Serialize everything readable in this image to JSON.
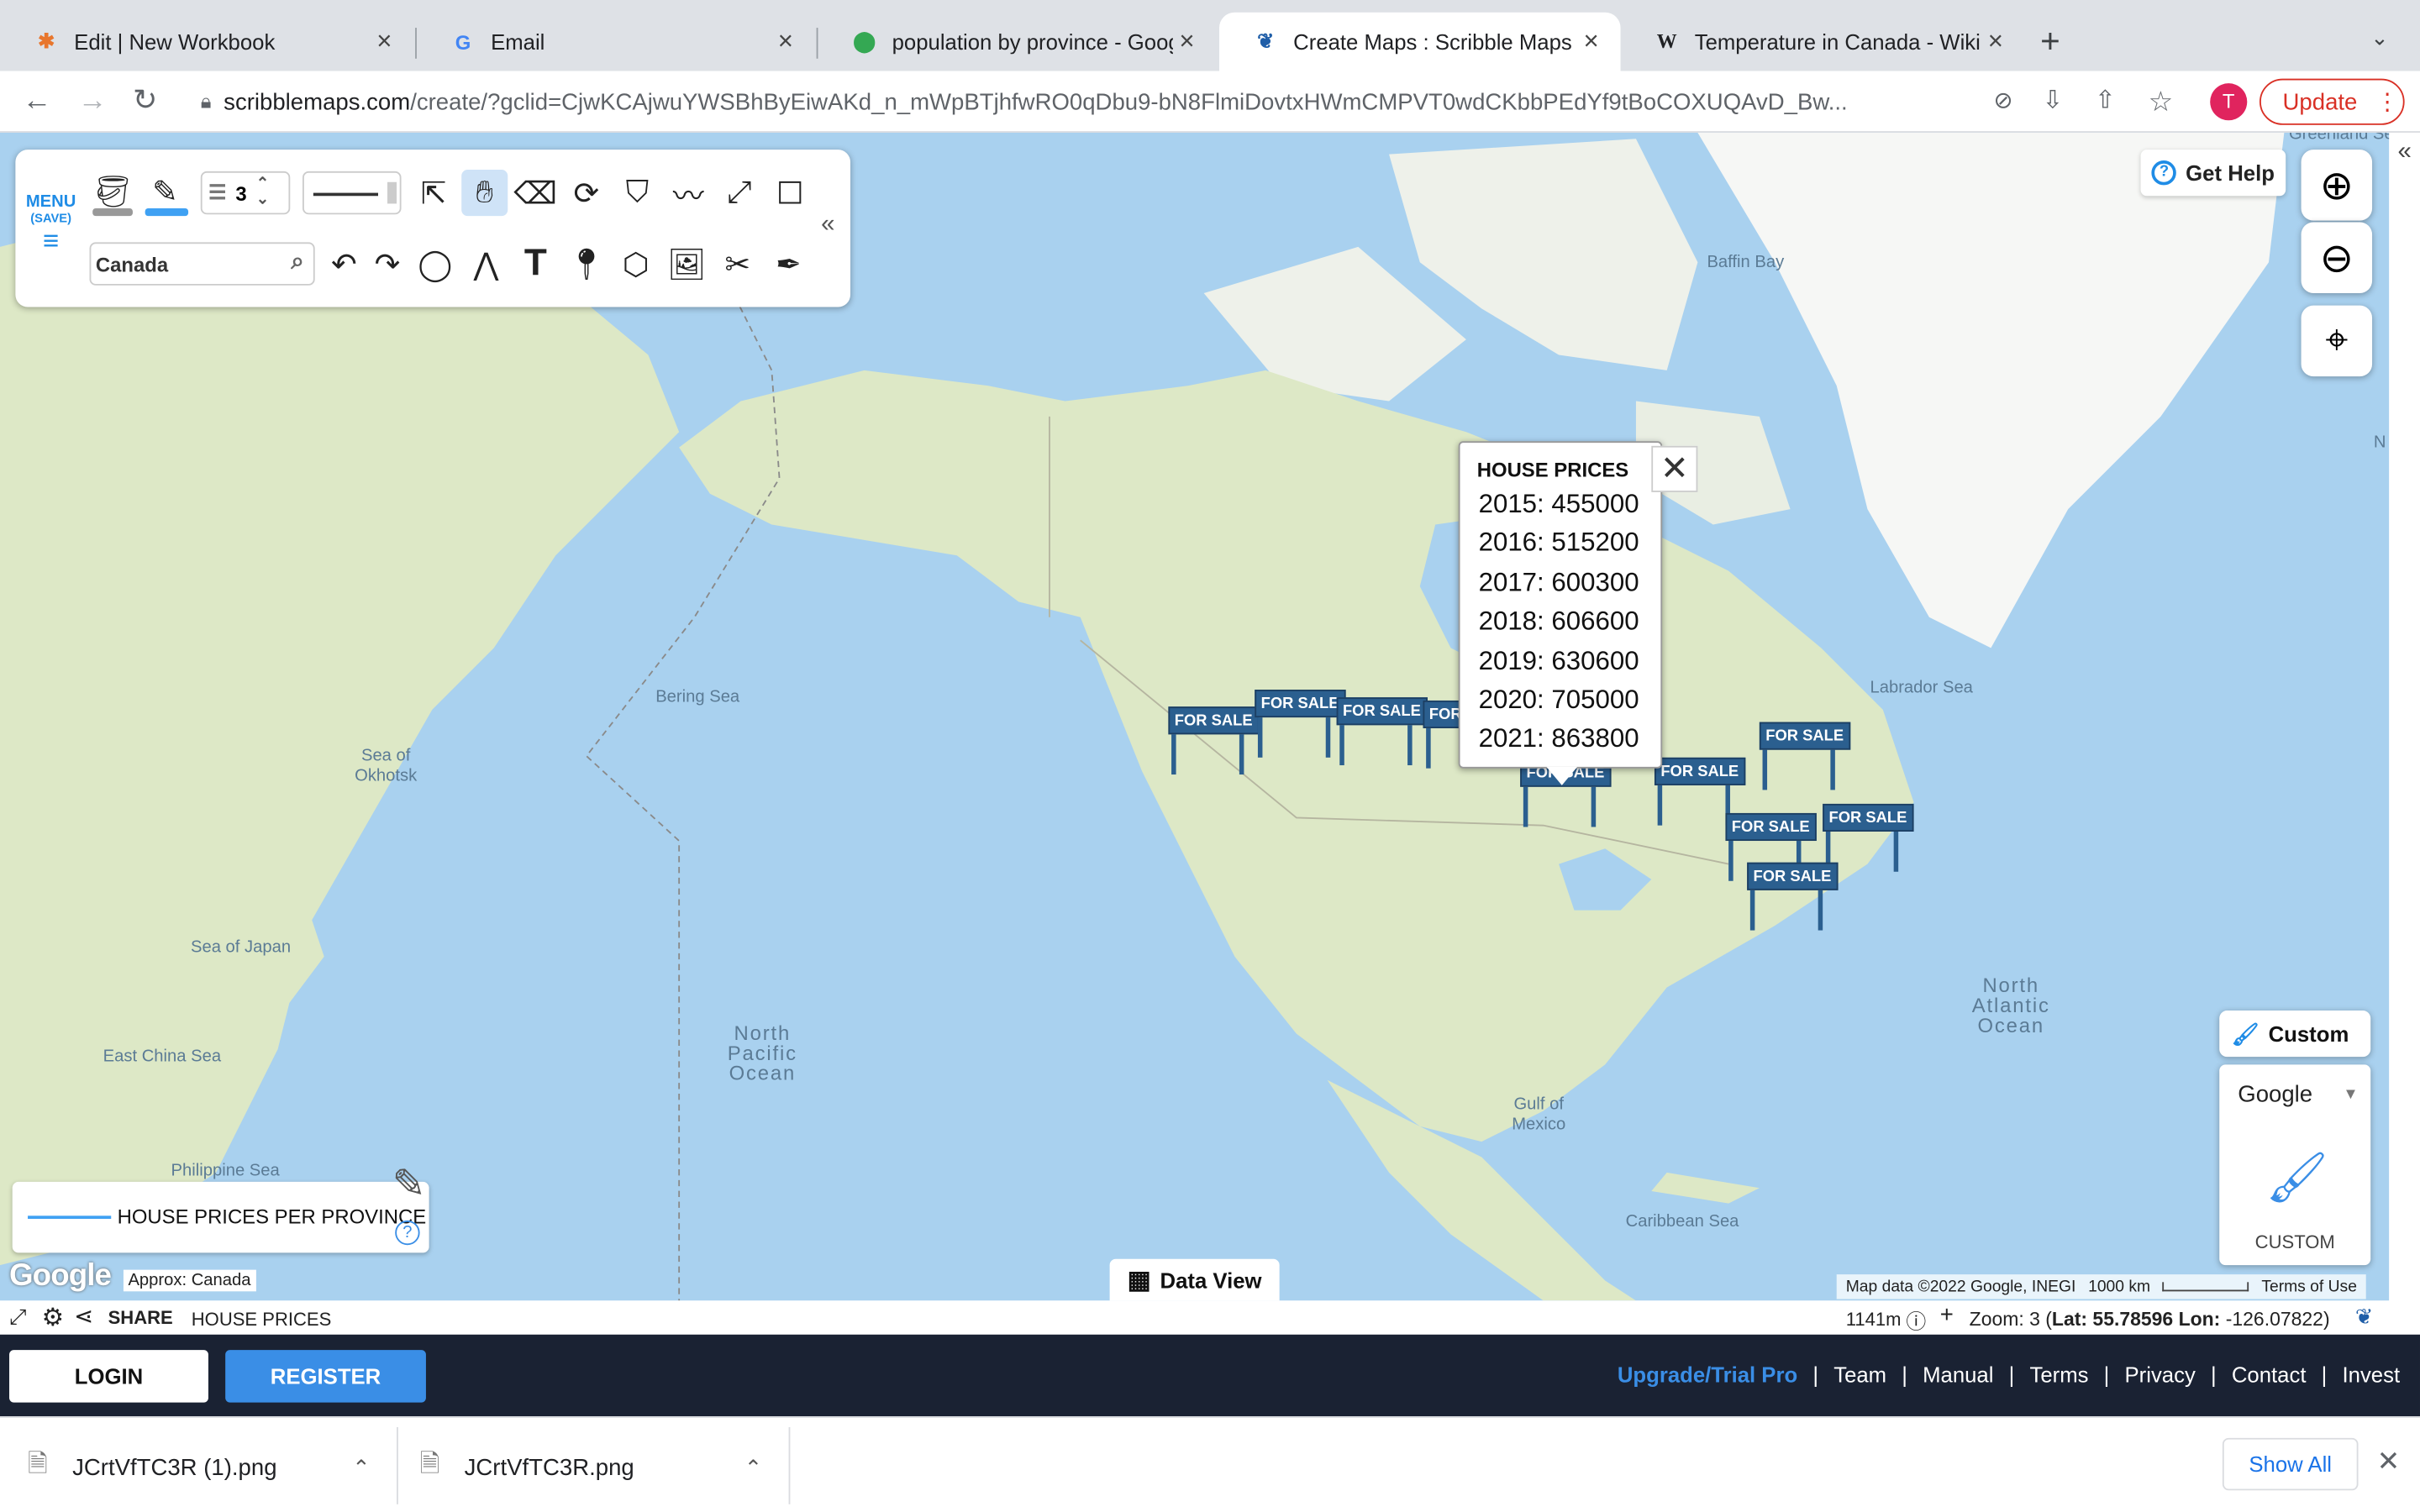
{
  "browser": {
    "tabs": [
      {
        "title": "Edit | New Workbook",
        "icon": "tableau-icon"
      },
      {
        "title": "Email",
        "icon": "google-icon"
      },
      {
        "title": "population by province - Googl",
        "icon": "maps-pin-icon"
      },
      {
        "title": "Create Maps : Scribble Maps",
        "icon": "scribblemaps-icon"
      },
      {
        "title": "Temperature in Canada - Wikip",
        "icon": "wikipedia-icon"
      }
    ],
    "url_host": "scribblemaps.com",
    "url_path": "/create/?gclid=CjwKCAjwuYWSBhByEiwAKd_n_mWpBTjhfwRO0qDbu9-bN8FlmiDovtxHWmCMPVT0wdCKbbPEdYf9tBoCOXUQAvD_Bw...",
    "profile_initial": "T",
    "update_label": "Update"
  },
  "toolbar": {
    "menu_label": "MENU",
    "menu_sub": "(SAVE)",
    "line_width": "3",
    "search_value": "Canada"
  },
  "map": {
    "labels": {
      "baffin_bay": "Baffin Bay",
      "labrador_sea": "Labrador Sea",
      "bering_sea": "Bering Sea",
      "sea_of_okhotsk": "Sea of Okhotsk",
      "sea_of_japan": "Sea of Japan",
      "east_china_sea": "East China Sea",
      "philippine_sea": "Philippine Sea",
      "north_pacific": "North Pacific Ocean",
      "north_atlantic": "North Atlantic Ocean",
      "gulf_of_mexico": "Gulf of Mexico",
      "caribbean_sea": "Caribbean Sea",
      "greenland_sea": "Greenland Se",
      "n_edge": "N"
    },
    "marker_label": "FOR SALE"
  },
  "popup": {
    "title": "HOUSE PRICES",
    "rows": [
      "2015: 455000",
      "2016: 515200",
      "2017: 600300",
      "2018: 606600",
      "2019: 630600",
      "2020: 705000",
      "2021: 863800"
    ]
  },
  "controls": {
    "get_help": "Get Help",
    "custom_label": "Custom",
    "basemap_select": "Google",
    "custom_caption": "CUSTOM"
  },
  "legend": {
    "title": "HOUSE PRICES PER PROVINCE"
  },
  "data_view_label": "Data View",
  "google_logo": "Google",
  "approx": "Approx: Canada",
  "attribution": {
    "mapdata": "Map data ©2022 Google, INEGI",
    "scale": "1000 km",
    "terms": "Terms of Use"
  },
  "status": {
    "share": "SHARE",
    "layer": "HOUSE PRICES",
    "elevation": "1141m",
    "zoom_prefix": "Zoom: 3 (",
    "lat_label": "Lat:",
    "lat": "55.78596",
    "lon_label": "Lon:",
    "lon": "-126.07822",
    "zoom_suffix": ")"
  },
  "footer": {
    "login": "LOGIN",
    "register": "REGISTER",
    "upgrade": "Upgrade/Trial Pro",
    "links": [
      "Team",
      "Manual",
      "Terms",
      "Privacy",
      "Contact",
      "Invest"
    ]
  },
  "downloads": {
    "items": [
      "JCrtVfTC3R (1).png",
      "JCrtVfTC3R.png"
    ],
    "show_all": "Show All"
  },
  "colors": {
    "accent": "#1f8ce6",
    "brand_dark": "#1a2233",
    "sign": "#2b5f8f",
    "water": "#a9d1ef",
    "land": "#dde8c6"
  }
}
